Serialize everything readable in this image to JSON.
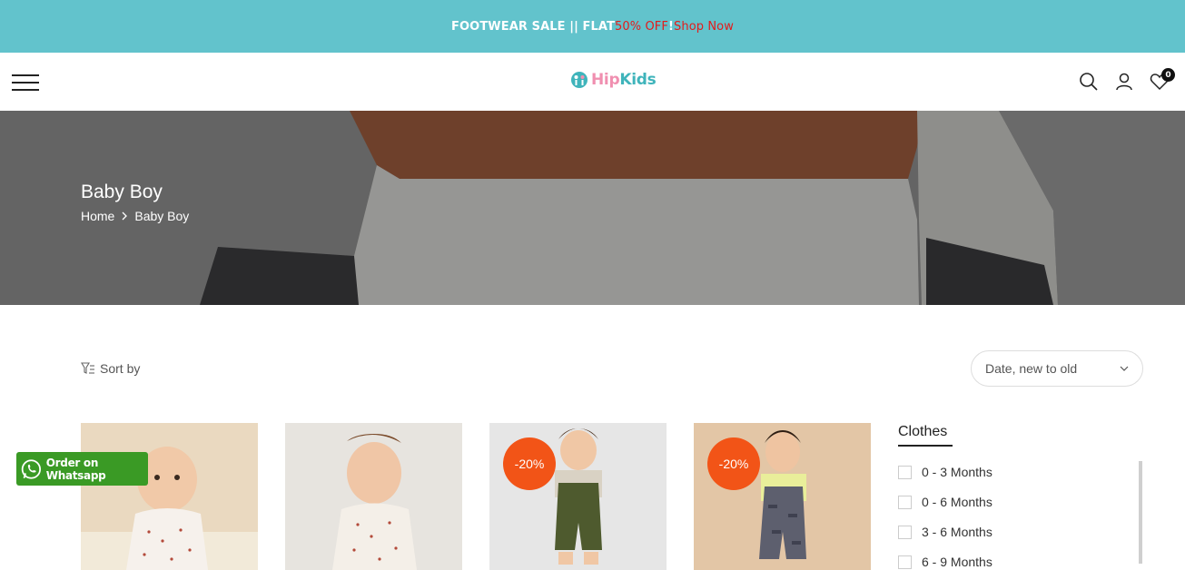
{
  "announcement": {
    "part1": "FOOTWEAR SALE || FLAT ",
    "highlight": "50% OFF",
    "sep": " ! ",
    "link": "Shop Now"
  },
  "header": {
    "logo_left": "Hip",
    "logo_right": "Kids",
    "cart_count": "0"
  },
  "hero": {
    "title": "Baby Boy",
    "breadcrumb": [
      "Home",
      "Baby Boy"
    ]
  },
  "toolbar": {
    "sort_label": "Sort by",
    "sort_value": "Date, new to old"
  },
  "products": [
    {
      "badge": ""
    },
    {
      "badge": ""
    },
    {
      "badge": "-20%"
    },
    {
      "badge": "-20%"
    }
  ],
  "filters": {
    "title": "Clothes",
    "items": [
      "0 - 3 Months",
      "0 - 6 Months",
      "3 - 6 Months",
      "6 - 9 Months"
    ]
  },
  "whatsapp": {
    "label": "Order on Whatsapp"
  },
  "colors": {
    "announce_bg": "#62c3cc",
    "sale_badge": "#f25417",
    "whatsapp": "#3a9a25",
    "highlight": "#e41b1b"
  }
}
